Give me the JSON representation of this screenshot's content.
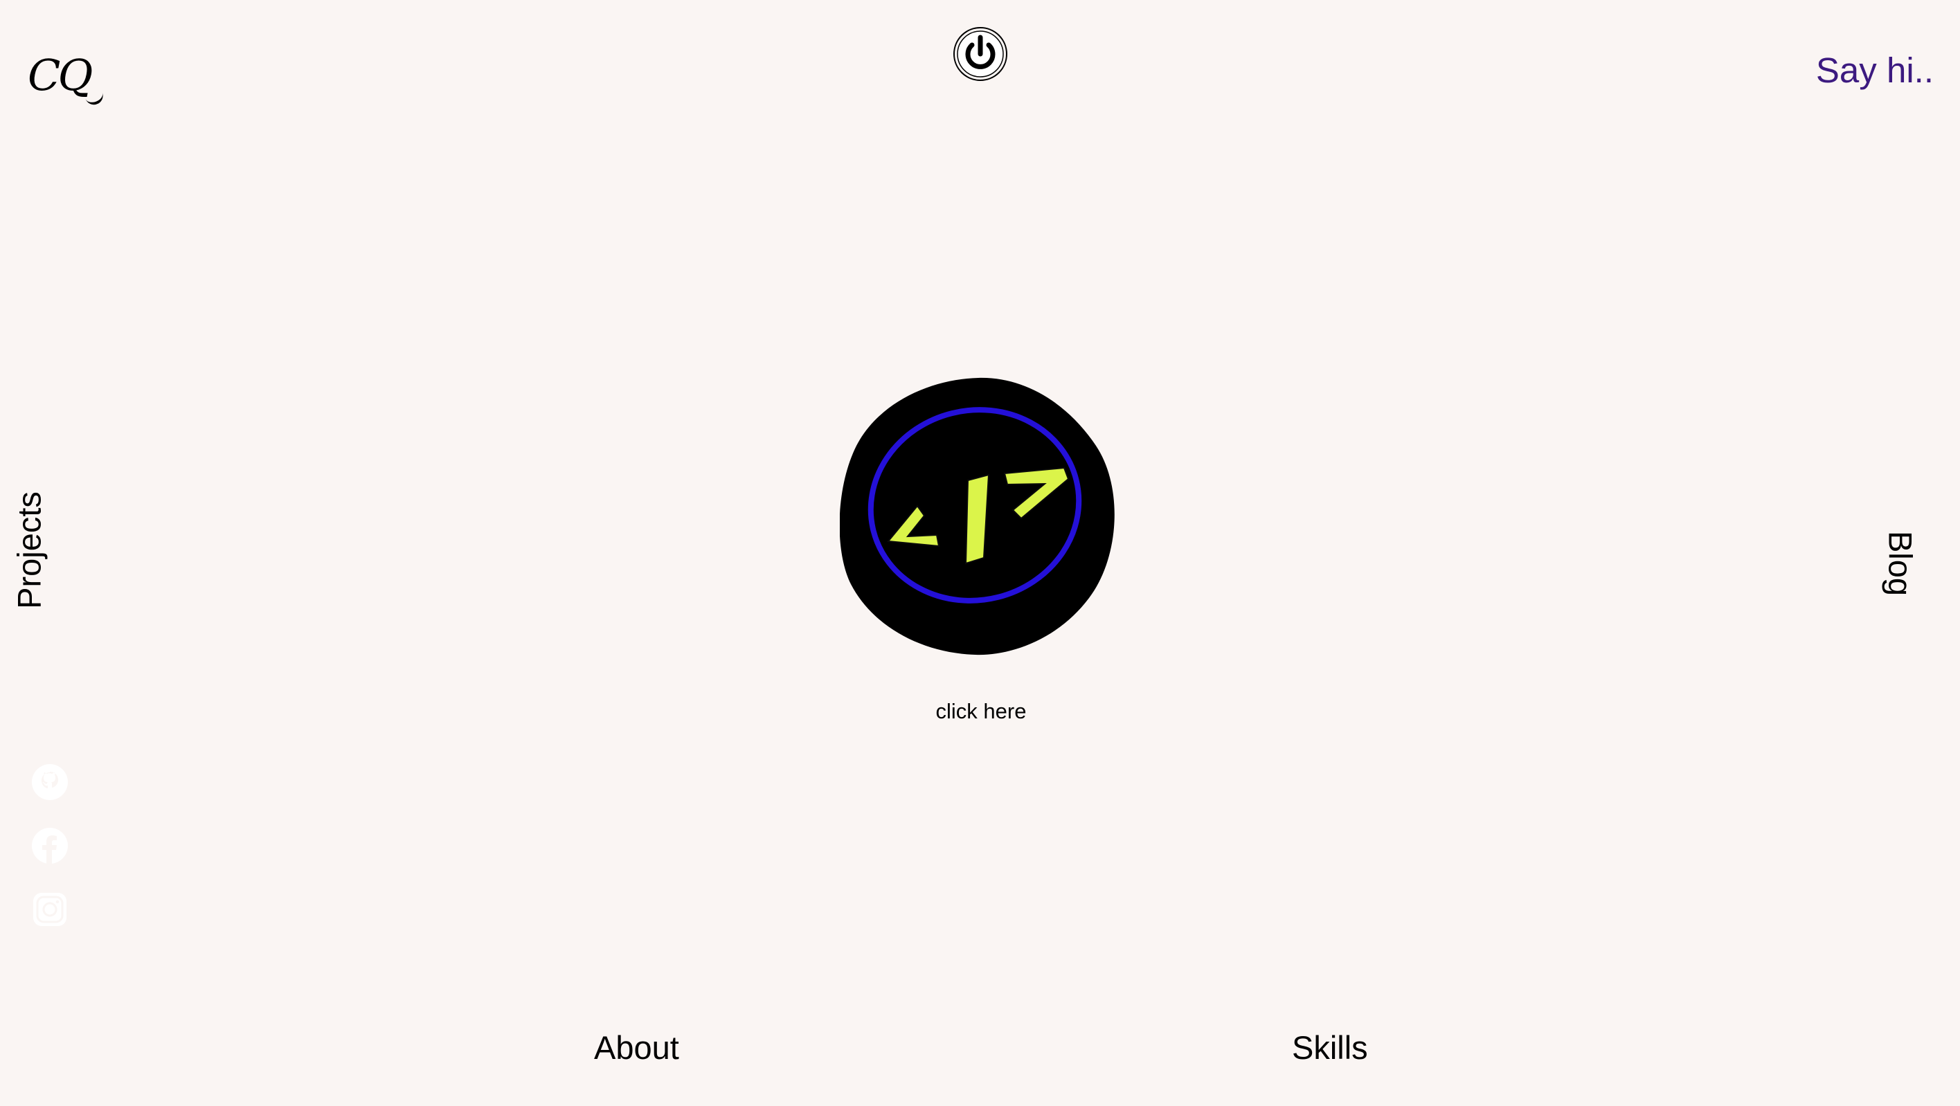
{
  "header": {
    "logo_text": "CQ",
    "power_icon": "power-icon",
    "contact_link": "Say hi.."
  },
  "nav": {
    "left": "Projects",
    "right": "Blog",
    "bottom_left": "About",
    "bottom_right": "Skills"
  },
  "hero": {
    "icon": "code-brackets-icon",
    "caption": "click here"
  },
  "social": [
    {
      "icon": "github-icon"
    },
    {
      "icon": "facebook-icon"
    },
    {
      "icon": "instagram-icon"
    }
  ],
  "colors": {
    "background": "#faf5f3",
    "accent_purple": "#3c1a80",
    "ring_blue": "#2410d8",
    "code_yellow": "#dbf44a"
  }
}
